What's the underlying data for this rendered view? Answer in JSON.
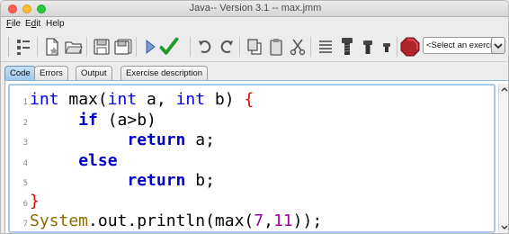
{
  "window": {
    "title": "Java-- Version 3.1 -- max.jmm",
    "traffic_colors": [
      "#ff5f57",
      "#febc2e",
      "#28c840"
    ]
  },
  "menu": {
    "file": {
      "mnemonic": "F",
      "rest": "ile"
    },
    "edit": {
      "pre": "E",
      "mnemonic": "d",
      "rest": "it"
    },
    "help": {
      "label": "Help"
    }
  },
  "toolbar": {
    "icons": [
      "hierarchy-icon",
      "new-file-icon",
      "open-folder-icon",
      "save-icon",
      "save-all-icon",
      "run-icon",
      "check-icon",
      "undo-icon",
      "redo-icon",
      "copy-icon",
      "paste-icon",
      "cut-icon",
      "format-icon",
      "bolt-large-icon",
      "bolt-medium-icon",
      "bolt-small-icon",
      "stop-icon"
    ],
    "exercise_select": "<Select an exercise>"
  },
  "tabs": [
    {
      "label": "Code",
      "active": true
    },
    {
      "label": "Errors",
      "active": false
    },
    {
      "label": "Output",
      "active": false
    },
    {
      "label": "Exercise description",
      "active": false
    }
  ],
  "code": {
    "line_numbers": [
      "1",
      "2",
      "3",
      "4",
      "5",
      "6",
      "7"
    ],
    "lines": [
      {
        "indent": "",
        "tokens": [
          [
            "kw",
            "int"
          ],
          [
            "plain",
            " max("
          ],
          [
            "kw",
            "int"
          ],
          [
            "plain",
            " a, "
          ],
          [
            "kw",
            "int"
          ],
          [
            "plain",
            " b) "
          ],
          [
            "brace",
            "{"
          ]
        ]
      },
      {
        "indent": "     ",
        "tokens": [
          [
            "ctl",
            "if"
          ],
          [
            "plain",
            " (a>b)"
          ]
        ]
      },
      {
        "indent": "          ",
        "tokens": [
          [
            "ctl",
            "return"
          ],
          [
            "plain",
            " a;"
          ]
        ]
      },
      {
        "indent": "     ",
        "tokens": [
          [
            "ctl",
            "else"
          ]
        ]
      },
      {
        "indent": "          ",
        "tokens": [
          [
            "ctl",
            "return"
          ],
          [
            "plain",
            " b;"
          ]
        ]
      },
      {
        "indent": "",
        "tokens": [
          [
            "brace",
            "}"
          ]
        ]
      },
      {
        "indent": "",
        "tokens": [
          [
            "sys",
            "System"
          ],
          [
            "plain",
            ".out.println(max("
          ],
          [
            "num",
            "7"
          ],
          [
            "plain",
            ","
          ],
          [
            "num",
            "11"
          ],
          [
            "plain",
            "));"
          ]
        ]
      }
    ]
  }
}
